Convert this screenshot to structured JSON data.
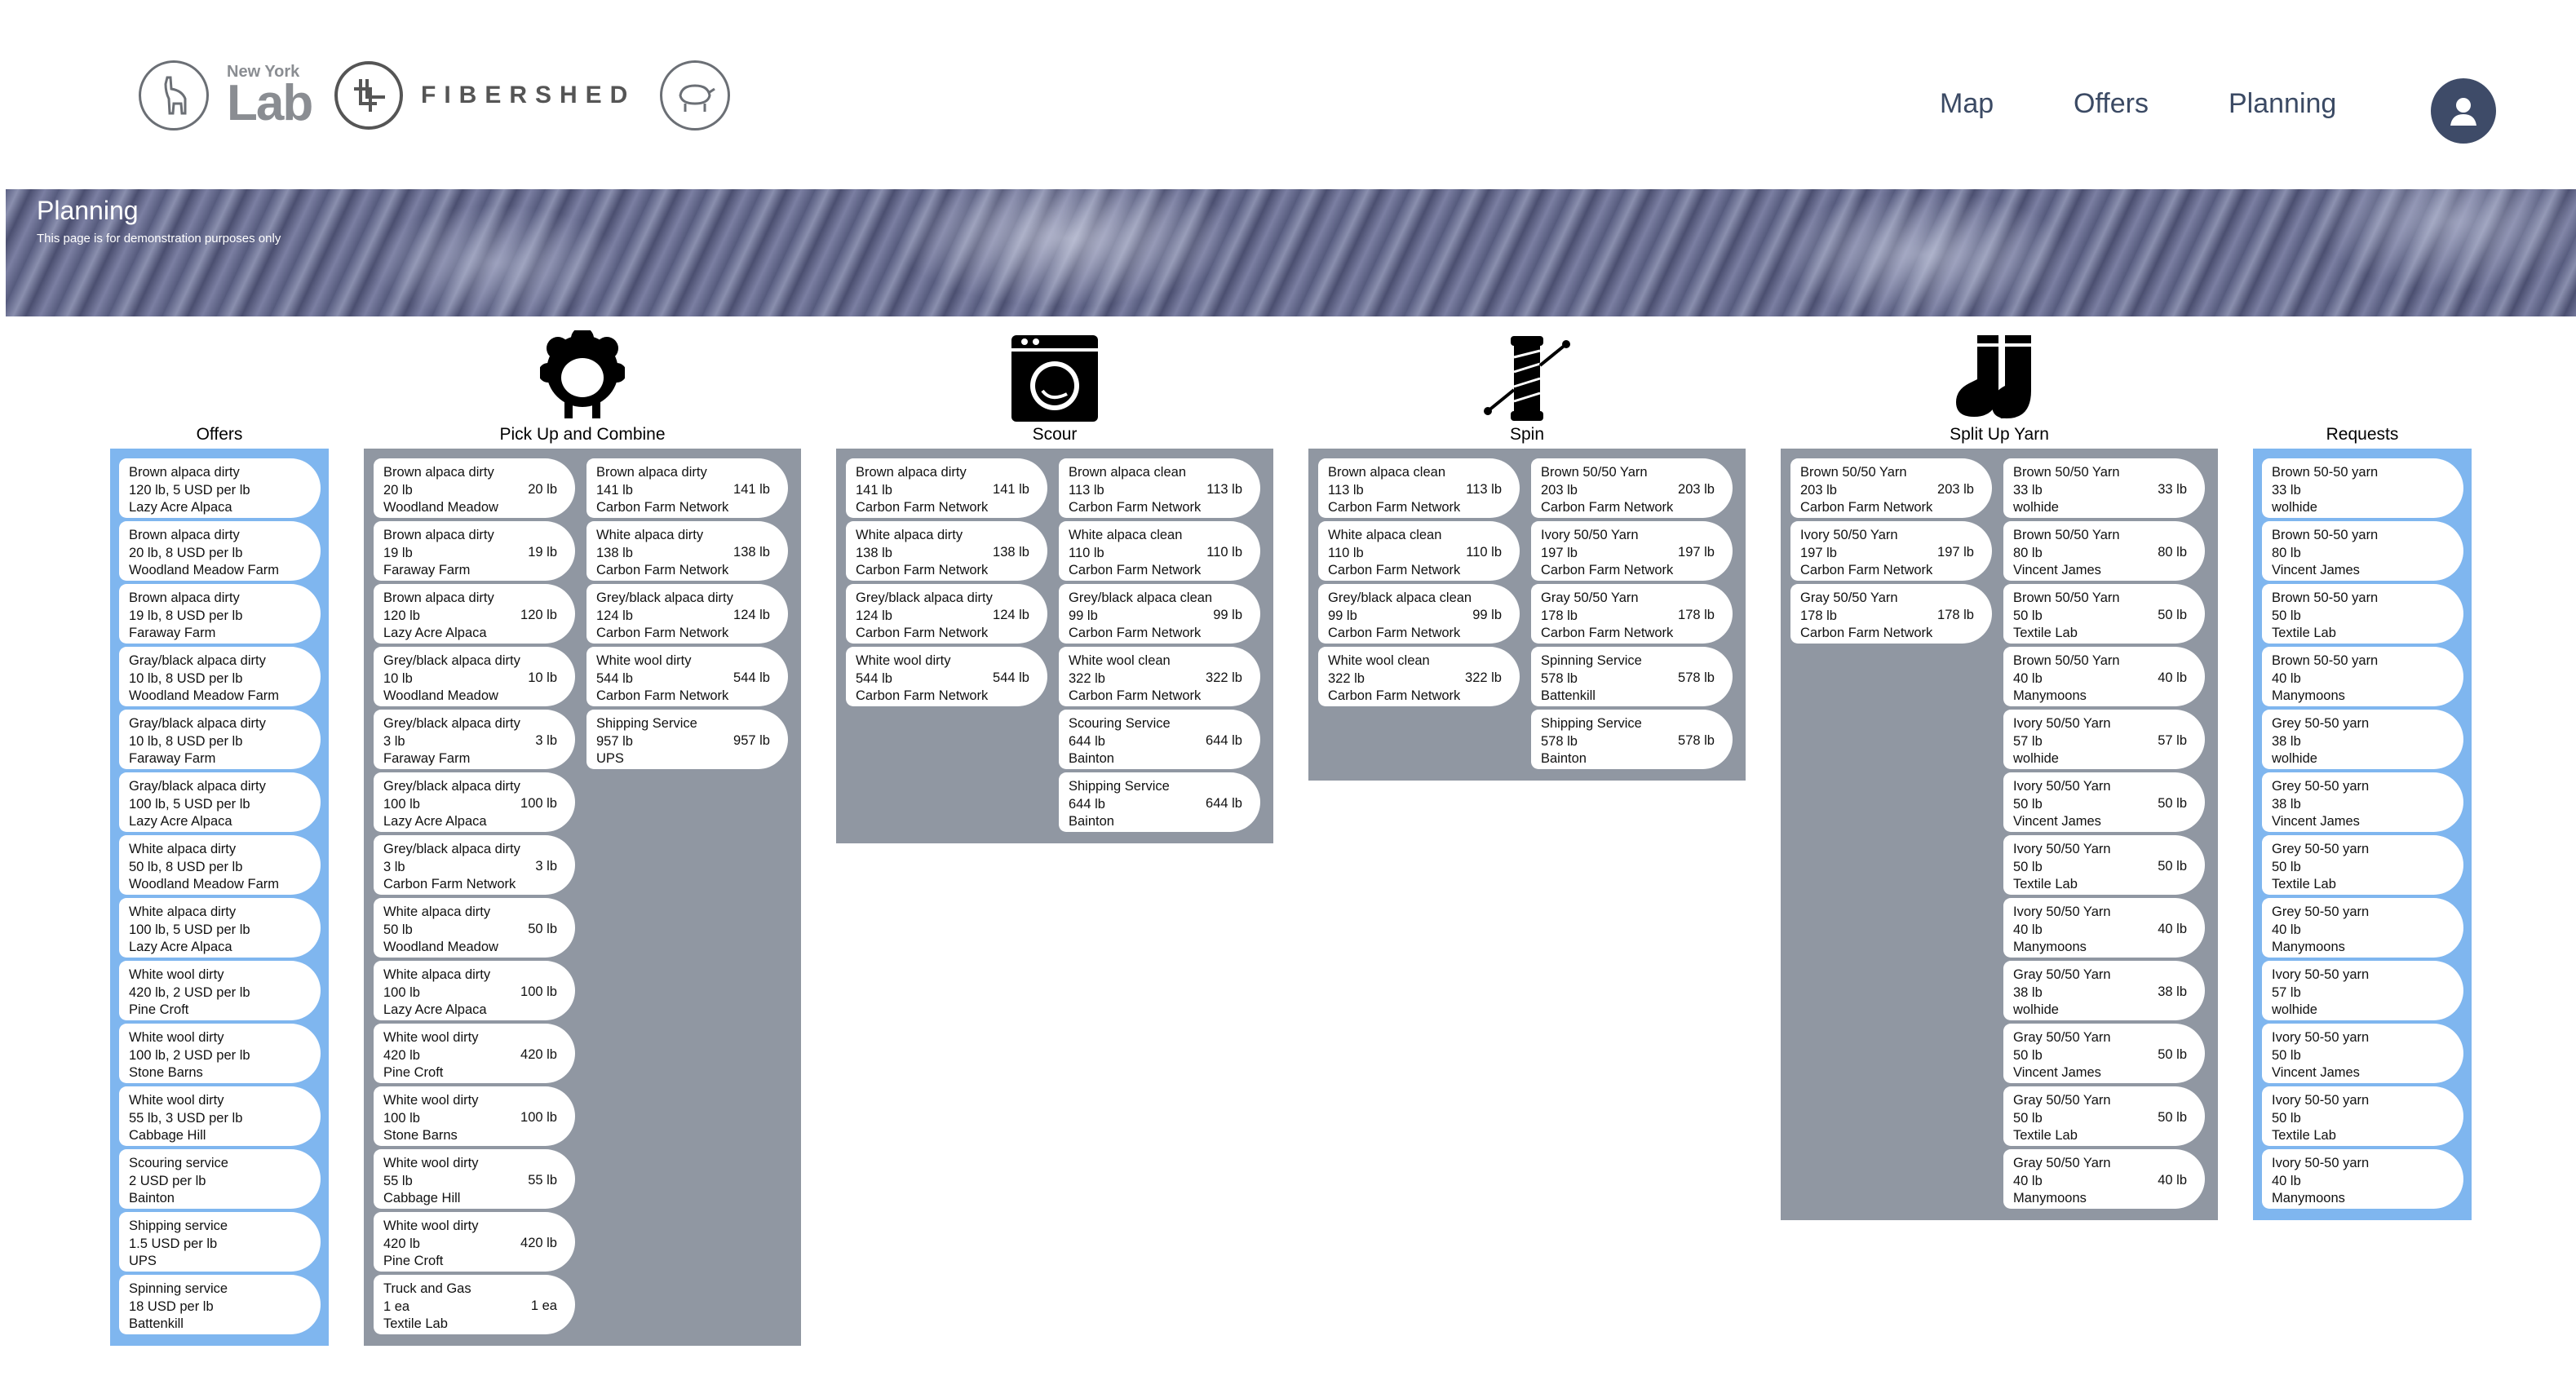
{
  "header": {
    "nav": [
      "Map",
      "Offers",
      "Planning"
    ],
    "logos": {
      "nyl_small": "New York",
      "nyl_big": "Lab",
      "fibershed": "FIBERSHED"
    },
    "avatar_icon": "user-avatar-icon"
  },
  "banner": {
    "title": "Planning",
    "subtitle": "This page is for demonstration purposes only"
  },
  "columns": {
    "offers": {
      "title": "Offers",
      "cards": [
        [
          "Brown alpaca dirty",
          "120 lb, 5 USD per lb",
          "Lazy Acre Alpaca"
        ],
        [
          "Brown alpaca dirty",
          "20 lb, 8 USD per lb",
          "Woodland Meadow Farm"
        ],
        [
          "Brown alpaca dirty",
          "19 lb, 8 USD per lb",
          "Faraway Farm"
        ],
        [
          "Gray/black alpaca dirty",
          "10 lb, 8 USD per lb",
          "Woodland Meadow Farm"
        ],
        [
          "Gray/black alpaca dirty",
          "10 lb, 8 USD per lb",
          "Faraway Farm"
        ],
        [
          "Gray/black alpaca dirty",
          "100 lb, 5 USD per lb",
          "Lazy Acre Alpaca"
        ],
        [
          "White alpaca dirty",
          "50 lb, 8 USD per lb",
          "Woodland Meadow Farm"
        ],
        [
          "White alpaca dirty",
          "100 lb, 5 USD per lb",
          "Lazy Acre Alpaca"
        ],
        [
          "White wool dirty",
          "420 lb, 2 USD per lb",
          "Pine Croft"
        ],
        [
          "White wool dirty",
          "100 lb, 2 USD per lb",
          "Stone Barns"
        ],
        [
          "White wool dirty",
          "55 lb, 3 USD per lb",
          "Cabbage Hill"
        ],
        [
          "Scouring service",
          "2 USD per lb",
          "Bainton"
        ],
        [
          "Shipping service",
          "1.5 USD per lb",
          "UPS"
        ],
        [
          "Spinning service",
          "18 USD per lb",
          "Battenkill"
        ]
      ]
    },
    "pickup": {
      "title": "Pick Up and Combine",
      "icon": "sheep-icon",
      "inputs": [
        [
          "Brown alpaca dirty",
          "20 lb",
          "Woodland Meadow",
          "20 lb"
        ],
        [
          "Brown alpaca dirty",
          "19 lb",
          "Faraway Farm",
          "19 lb"
        ],
        [
          "Brown alpaca dirty",
          "120 lb",
          "Lazy Acre Alpaca",
          "120 lb"
        ],
        [
          "Grey/black alpaca dirty",
          "10 lb",
          "Woodland Meadow",
          "10 lb"
        ],
        [
          "Grey/black alpaca dirty",
          "3 lb",
          "Faraway Farm",
          "3 lb"
        ],
        [
          "Grey/black alpaca dirty",
          "100 lb",
          "Lazy Acre Alpaca",
          "100 lb"
        ],
        [
          "Grey/black alpaca dirty",
          "3 lb",
          "Carbon Farm Network",
          "3 lb"
        ],
        [
          "White alpaca dirty",
          "50 lb",
          "Woodland Meadow",
          "50 lb"
        ],
        [
          "White alpaca dirty",
          "100 lb",
          "Lazy Acre Alpaca",
          "100 lb"
        ],
        [
          "White wool dirty",
          "420 lb",
          "Pine Croft",
          "420 lb"
        ],
        [
          "White wool dirty",
          "100 lb",
          "Stone Barns",
          "100 lb"
        ],
        [
          "White wool dirty",
          "55 lb",
          "Cabbage Hill",
          "55 lb"
        ],
        [
          "White wool dirty",
          "420 lb",
          "Pine Croft",
          "420 lb"
        ],
        [
          "Truck and Gas",
          "1 ea",
          "Textile Lab",
          "1 ea"
        ]
      ],
      "outputs": [
        [
          "Brown alpaca dirty",
          "141 lb",
          "Carbon Farm Network",
          "141 lb"
        ],
        [
          "White alpaca dirty",
          "138 lb",
          "Carbon Farm Network",
          "138 lb"
        ],
        [
          "Grey/black alpaca dirty",
          "124 lb",
          "Carbon Farm Network",
          "124 lb"
        ],
        [
          "White wool dirty",
          "544 lb",
          "Carbon Farm Network",
          "544 lb"
        ],
        [
          "Shipping Service",
          "957 lb",
          "UPS",
          "957 lb"
        ]
      ]
    },
    "scour": {
      "title": "Scour",
      "icon": "washing-machine-icon",
      "inputs": [
        [
          "Brown alpaca dirty",
          "141 lb",
          "Carbon Farm Network",
          "141 lb"
        ],
        [
          "White alpaca dirty",
          "138 lb",
          "Carbon Farm Network",
          "138 lb"
        ],
        [
          "Grey/black alpaca dirty",
          "124 lb",
          "Carbon Farm Network",
          "124 lb"
        ],
        [
          "White wool dirty",
          "544 lb",
          "Carbon Farm Network",
          "544 lb"
        ]
      ],
      "outputs": [
        [
          "Brown alpaca clean",
          "113 lb",
          "Carbon Farm Network",
          "113 lb"
        ],
        [
          "White alpaca clean",
          "110 lb",
          "Carbon Farm Network",
          "110 lb"
        ],
        [
          "Grey/black alpaca clean",
          "99 lb",
          "Carbon Farm Network",
          "99 lb"
        ],
        [
          "White wool clean",
          "322 lb",
          "Carbon Farm Network",
          "322 lb"
        ],
        [
          "Scouring Service",
          "644 lb",
          "Bainton",
          "644 lb"
        ],
        [
          "Shipping Service",
          "644 lb",
          "Bainton",
          "644 lb"
        ]
      ]
    },
    "spin": {
      "title": "Spin",
      "icon": "yarn-spool-icon",
      "inputs": [
        [
          "Brown alpaca clean",
          "113 lb",
          "Carbon Farm Network",
          "113 lb"
        ],
        [
          "White alpaca clean",
          "110 lb",
          "Carbon Farm Network",
          "110 lb"
        ],
        [
          "Grey/black alpaca clean",
          "99 lb",
          "Carbon Farm Network",
          "99 lb"
        ],
        [
          "White wool clean",
          "322 lb",
          "Carbon Farm Network",
          "322 lb"
        ]
      ],
      "outputs": [
        [
          "Brown 50/50 Yarn",
          "203 lb",
          "Carbon Farm Network",
          "203 lb"
        ],
        [
          "Ivory 50/50 Yarn",
          "197 lb",
          "Carbon Farm Network",
          "197 lb"
        ],
        [
          "Gray 50/50 Yarn",
          "178 lb",
          "Carbon Farm Network",
          "178 lb"
        ],
        [
          "Spinning Service",
          "578 lb",
          "Battenkill",
          "578 lb"
        ],
        [
          "Shipping Service",
          "578 lb",
          "Bainton",
          "578 lb"
        ]
      ]
    },
    "split": {
      "title": "Split Up Yarn",
      "icon": "socks-icon",
      "inputs": [
        [
          "Brown 50/50 Yarn",
          "203 lb",
          "Carbon Farm Network",
          "203 lb"
        ],
        [
          "Ivory 50/50 Yarn",
          "197 lb",
          "Carbon Farm Network",
          "197 lb"
        ],
        [
          "Gray 50/50 Yarn",
          "178 lb",
          "Carbon Farm Network",
          "178 lb"
        ]
      ],
      "outputs": [
        [
          "Brown 50/50 Yarn",
          "33 lb",
          "wolhide",
          "33 lb"
        ],
        [
          "Brown 50/50 Yarn",
          "80 lb",
          "Vincent James",
          "80 lb"
        ],
        [
          "Brown 50/50 Yarn",
          "50 lb",
          "Textile Lab",
          "50 lb"
        ],
        [
          "Brown 50/50 Yarn",
          "40 lb",
          "Manymoons",
          "40 lb"
        ],
        [
          "Ivory 50/50 Yarn",
          "57 lb",
          "wolhide",
          "57 lb"
        ],
        [
          "Ivory 50/50 Yarn",
          "50 lb",
          "Vincent James",
          "50 lb"
        ],
        [
          "Ivory 50/50 Yarn",
          "50 lb",
          "Textile Lab",
          "50 lb"
        ],
        [
          "Ivory 50/50 Yarn",
          "40 lb",
          "Manymoons",
          "40 lb"
        ],
        [
          "Gray 50/50 Yarn",
          "38 lb",
          "wolhide",
          "38 lb"
        ],
        [
          "Gray 50/50 Yarn",
          "50 lb",
          "Vincent James",
          "50 lb"
        ],
        [
          "Gray 50/50 Yarn",
          "50 lb",
          "Textile Lab",
          "50 lb"
        ],
        [
          "Gray 50/50 Yarn",
          "40 lb",
          "Manymoons",
          "40 lb"
        ]
      ]
    },
    "requests": {
      "title": "Requests",
      "cards": [
        [
          "Brown 50-50 yarn",
          "33 lb",
          "wolhide"
        ],
        [
          "Brown 50-50 yarn",
          "80 lb",
          "Vincent James"
        ],
        [
          "Brown 50-50 yarn",
          "50 lb",
          "Textile Lab"
        ],
        [
          "Brown 50-50 yarn",
          "40 lb",
          "Manymoons"
        ],
        [
          "Grey 50-50 yarn",
          "38 lb",
          "wolhide"
        ],
        [
          "Grey 50-50 yarn",
          "38 lb",
          "Vincent James"
        ],
        [
          "Grey 50-50 yarn",
          "50 lb",
          "Textile Lab"
        ],
        [
          "Grey 50-50 yarn",
          "40 lb",
          "Manymoons"
        ],
        [
          "Ivory 50-50 yarn",
          "57 lb",
          "wolhide"
        ],
        [
          "Ivory 50-50 yarn",
          "50 lb",
          "Vincent James"
        ],
        [
          "Ivory 50-50 yarn",
          "50 lb",
          "Textile Lab"
        ],
        [
          "Ivory 50-50 yarn",
          "40 lb",
          "Manymoons"
        ]
      ]
    }
  },
  "colors": {
    "offers_panel": "#7fb6ef",
    "stage_panel": "#9097a2",
    "nav_text": "#3b4a64",
    "avatar": "#3e4b68"
  }
}
